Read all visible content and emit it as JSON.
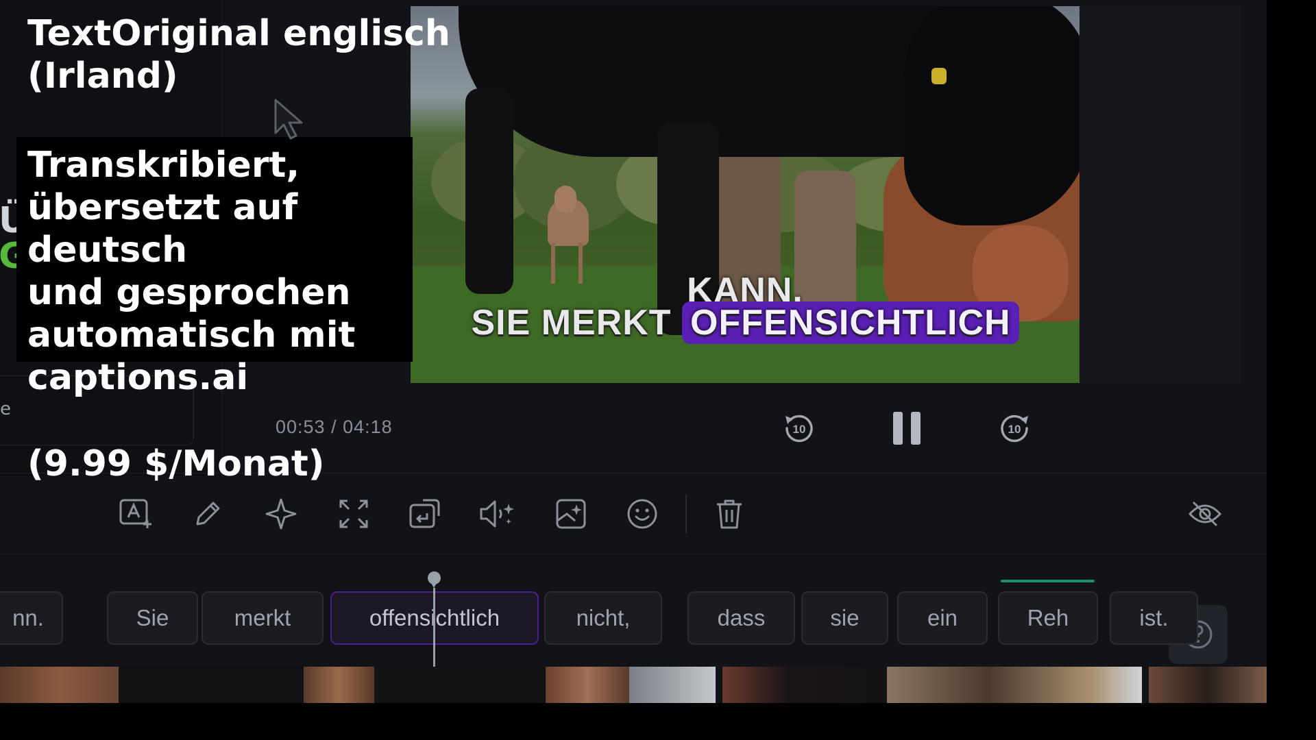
{
  "overlay": {
    "title": "TextOriginal englisch\n (Irland)",
    "description": "Transkribiert,\nübersetzt auf\ndeutsch\nund gesprochen\nautomatisch mit\ncaptions.ai",
    "price": "(9.99 $/Monat)"
  },
  "left_panel": {
    "partial_heading_1": "Ü",
    "partial_heading_2": "G",
    "card_text_fragment": "e"
  },
  "video": {
    "subtitle_top": "KANN.",
    "subtitle_lead": "SIE MERKT",
    "subtitle_highlight": "OFFENSICHTLICH"
  },
  "playback": {
    "timecode": "00:53 / 04:18",
    "skip_back_label": "10",
    "skip_forward_label": "10"
  },
  "toolbar": {
    "tools": [
      "add-text-icon",
      "pencil-icon",
      "sparkle-icon",
      "expand-icon",
      "replace-clip-icon",
      "ai-voice-icon",
      "ai-image-icon",
      "emoji-icon",
      "trash-icon",
      "eye-off-icon"
    ]
  },
  "captions": {
    "words": [
      "nn.",
      "Sie",
      "merkt",
      "offensichtlich",
      "nicht,",
      "dass",
      "sie",
      "ein",
      "Reh",
      "ist."
    ],
    "active_word": "offensichtlich"
  },
  "colors": {
    "accent_purple": "#5a1fb5",
    "active_chip_border": "#4a2090",
    "progress_green": "#1d8f6a",
    "background": "#121318"
  }
}
